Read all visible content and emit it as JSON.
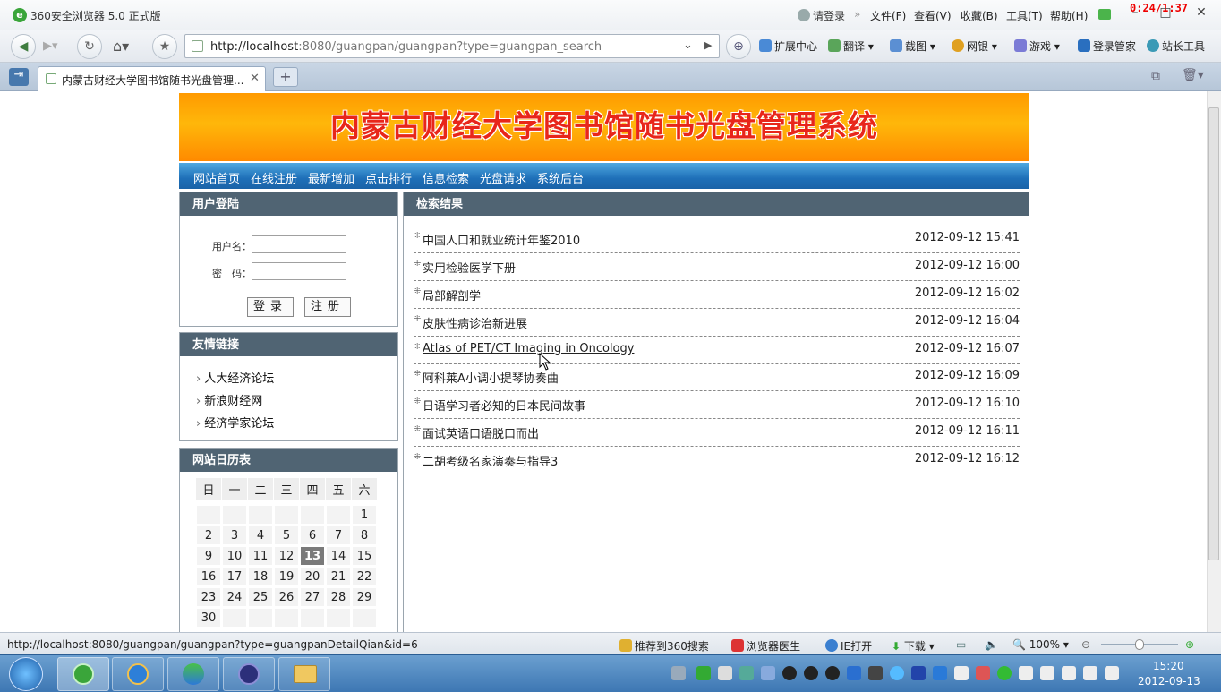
{
  "browser": {
    "title": "360安全浏览器 5.0 正式版",
    "login_link": "请登录",
    "menus": [
      "文件(F)",
      "查看(V)",
      "收藏(B)",
      "工具(T)",
      "帮助(H)"
    ],
    "timer": "0:24/1:37",
    "url_host": "http://localhost",
    "url_rest": ":8080/guangpan/guangpan?type=guangpan_search",
    "toolbar": [
      "扩展中心",
      "翻译",
      "截图",
      "网银",
      "游戏",
      "登录管家",
      "站长工具"
    ],
    "tab_title": "内蒙古财经大学图书馆随书光盘管理..."
  },
  "site": {
    "banner": "内蒙古财经大学图书馆随书光盘管理系统",
    "nav": [
      "网站首页",
      "在线注册",
      "最新增加",
      "点击排行",
      "信息检索",
      "光盘请求",
      "系统后台"
    ]
  },
  "login": {
    "title": "用户登陆",
    "username_label": "用户名：",
    "password_label": "密　码：",
    "username_value": "",
    "password_value": "",
    "login_btn": "登录",
    "register_btn": "注册"
  },
  "links": {
    "title": "友情链接",
    "items": [
      "人大经济论坛",
      "新浪财经网",
      "经济学家论坛"
    ]
  },
  "calendar": {
    "title": "网站日历表",
    "weekdays": [
      "日",
      "一",
      "二",
      "三",
      "四",
      "五",
      "六"
    ],
    "weeks": [
      [
        "",
        "",
        "",
        "",
        "",
        "",
        "1"
      ],
      [
        "2",
        "3",
        "4",
        "5",
        "6",
        "7",
        "8"
      ],
      [
        "9",
        "10",
        "11",
        "12",
        "13",
        "14",
        "15"
      ],
      [
        "16",
        "17",
        "18",
        "19",
        "20",
        "21",
        "22"
      ],
      [
        "23",
        "24",
        "25",
        "26",
        "27",
        "28",
        "29"
      ],
      [
        "30",
        "",
        "",
        "",
        "",
        "",
        ""
      ]
    ],
    "today": "13"
  },
  "results": {
    "title": "检索结果",
    "items": [
      {
        "title": "中国人口和就业统计年鉴2010",
        "date": "2012-09-12 15:41"
      },
      {
        "title": "实用检验医学下册",
        "date": "2012-09-12 16:00"
      },
      {
        "title": "局部解剖学",
        "date": "2012-09-12 16:02"
      },
      {
        "title": "皮肤性病诊治新进展",
        "date": "2012-09-12 16:04"
      },
      {
        "title": "Atlas of PET/CT Imaging in Oncology",
        "date": "2012-09-12 16:07"
      },
      {
        "title": "阿科莱A小调小提琴协奏曲",
        "date": "2012-09-12 16:09"
      },
      {
        "title": "日语学习者必知的日本民间故事",
        "date": "2012-09-12 16:10"
      },
      {
        "title": "面试英语口语脱口而出",
        "date": "2012-09-12 16:11"
      },
      {
        "title": "二胡考级名家演奏与指导3",
        "date": "2012-09-12 16:12"
      }
    ]
  },
  "statusbar": {
    "link_url": "http://localhost:8080/guangpan/guangpan?type=guangpanDetailQian&id=6",
    "recommend": "推荐到360搜索",
    "doctor": "浏览器医生",
    "ie_open": "IE打开",
    "download": "下载",
    "zoom": "100%"
  },
  "taskbar": {
    "time": "15:20",
    "date": "2012-09-13"
  },
  "colors": {
    "banner_orange": "#ff9a00",
    "banner_text": "#e8261a",
    "nav_blue": "#1e6fb8",
    "panel_header": "#506473",
    "today_bg": "#7a7a7a"
  }
}
